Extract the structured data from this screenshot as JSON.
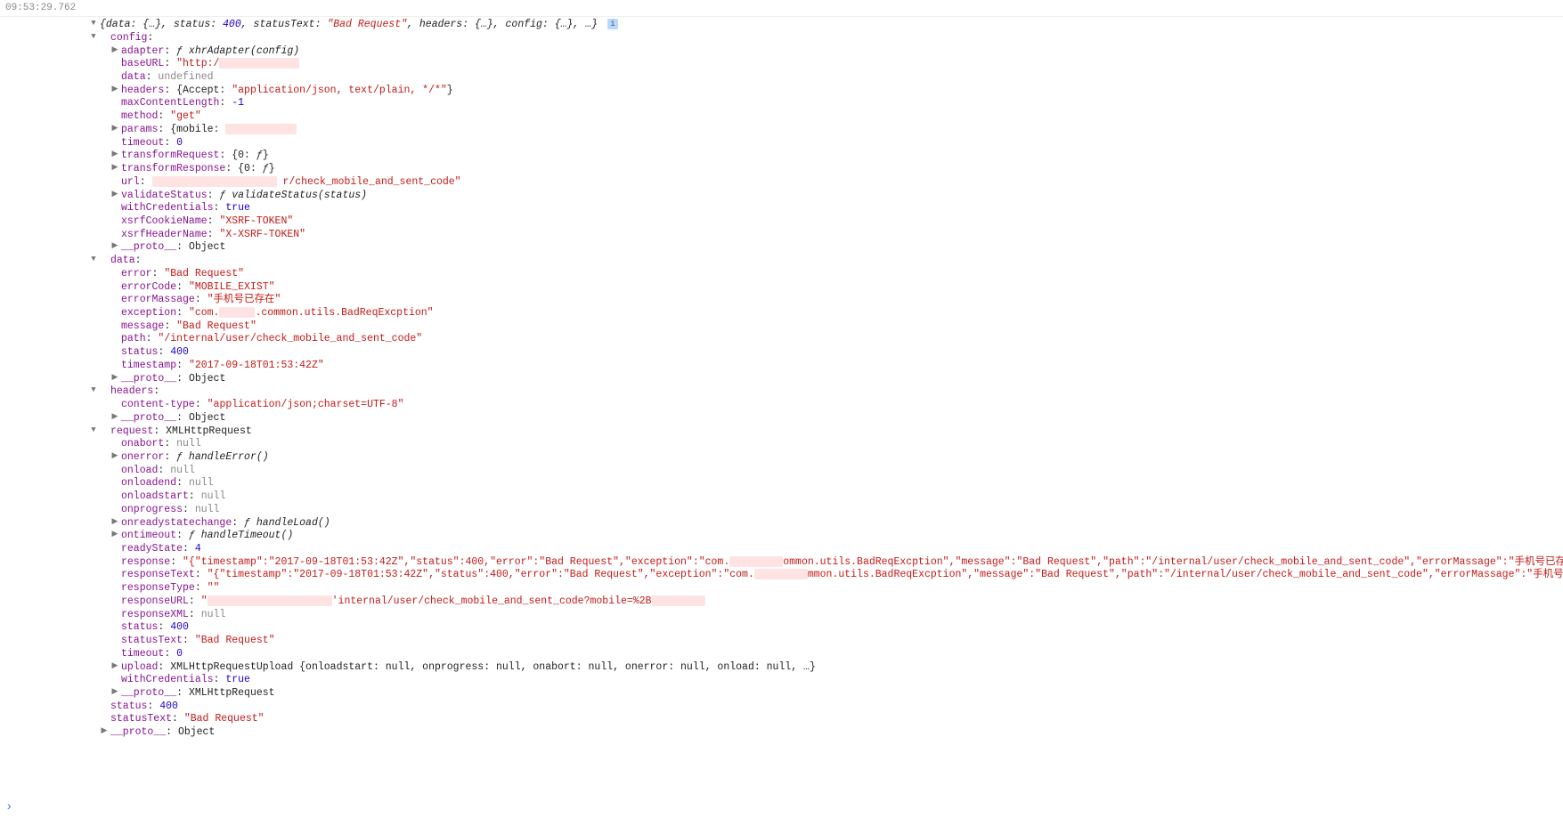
{
  "timestamp": "09:53:29.762",
  "top_summary": "{data: {…}, status: 400, statusText: \"Bad Request\", headers: {…}, config: {…}, …}",
  "status_num": "400",
  "status_text": "\"Bad Request\"",
  "config": {
    "label": "config",
    "adapter_key": "adapter",
    "adapter_val": "ƒ xhrAdapter(config)",
    "baseURL_key": "baseURL",
    "baseURL_val_prefix": "\"http:/",
    "data_key": "data",
    "data_val": "undefined",
    "headers_key": "headers",
    "headers_val": "{Accept: \"application/json, text/plain, */*\"}",
    "headers_accept": "\"application/json, text/plain, */*\"",
    "maxContentLength_key": "maxContentLength",
    "maxContentLength_val": "-1",
    "method_key": "method",
    "method_val": "\"get\"",
    "params_key": "params",
    "params_val_prefix": "{mobile: ",
    "timeout_key": "timeout",
    "timeout_val": "0",
    "transformRequest_key": "transformRequest",
    "transformRequest_val": "{0: ƒ}",
    "transformResponse_key": "transformResponse",
    "transformResponse_val": "{0: ƒ}",
    "url_key": "url",
    "url_suffix": "r/check_mobile_and_sent_code\"",
    "validateStatus_key": "validateStatus",
    "validateStatus_val": "ƒ validateStatus(status)",
    "withCredentials_key": "withCredentials",
    "withCredentials_val": "true",
    "xsrfCookieName_key": "xsrfCookieName",
    "xsrfCookieName_val": "\"XSRF-TOKEN\"",
    "xsrfHeaderName_key": "xsrfHeaderName",
    "xsrfHeaderName_val": "\"X-XSRF-TOKEN\"",
    "proto_key": "__proto__",
    "proto_val": "Object"
  },
  "data": {
    "label": "data",
    "error_key": "error",
    "error_val": "\"Bad Request\"",
    "errorCode_key": "errorCode",
    "errorCode_val": "\"MOBILE_EXIST\"",
    "errorMassage_key": "errorMassage",
    "errorMassage_val": "\"手机号已存在\"",
    "exception_key": "exception",
    "exception_prefix": "\"com.",
    "exception_suffix": ".common.utils.BadReqExcption\"",
    "message_key": "message",
    "message_val": "\"Bad Request\"",
    "path_key": "path",
    "path_val": "\"/internal/user/check_mobile_and_sent_code\"",
    "status_key": "status",
    "status_val": "400",
    "timestamp_key": "timestamp",
    "timestamp_val": "\"2017-09-18T01:53:42Z\"",
    "proto_key": "__proto__",
    "proto_val": "Object"
  },
  "headers": {
    "label": "headers",
    "contentType_key": "content-type",
    "contentType_val": "\"application/json;charset=UTF-8\"",
    "proto_key": "__proto__",
    "proto_val": "Object"
  },
  "request": {
    "label": "request",
    "type": "XMLHttpRequest",
    "onabort_key": "onabort",
    "onabort_val": "null",
    "onerror_key": "onerror",
    "onerror_val": "ƒ handleError()",
    "onload_key": "onload",
    "onload_val": "null",
    "onloadend_key": "onloadend",
    "onloadend_val": "null",
    "onloadstart_key": "onloadstart",
    "onloadstart_val": "null",
    "onprogress_key": "onprogress",
    "onprogress_val": "null",
    "onreadystatechange_key": "onreadystatechange",
    "onreadystatechange_val": "ƒ handleLoad()",
    "ontimeout_key": "ontimeout",
    "ontimeout_val": "ƒ handleTimeout()",
    "readyState_key": "readyState",
    "readyState_val": "4",
    "response_key": "response",
    "response_prefix": "\"{\"timestamp\":\"2017-09-18T01:53:42Z\",\"status\":400,\"error\":\"Bad Request\",\"exception\":\"com.",
    "response_suffix": "ommon.utils.BadReqExcption\",\"message\":\"Bad Request\",\"path\":\"/internal/user/check_mobile_and_sent_code\",\"errorMassage\":\"手机号已存在\",\"err",
    "responseText_key": "responseText",
    "responseText_prefix": "\"{\"timestamp\":\"2017-09-18T01:53:42Z\",\"status\":400,\"error\":\"Bad Request\",\"exception\":\"com.",
    "responseText_suffix": "mmon.utils.BadReqExcption\",\"message\":\"Bad Request\",\"path\":\"/internal/user/check_mobile_and_sent_code\",\"errorMassage\":\"手机号已存在\"",
    "responseType_key": "responseType",
    "responseType_val": "\"\"",
    "responseURL_key": "responseURL",
    "responseURL_mid": "'internal/user/check_mobile_and_sent_code?mobile=%2B",
    "responseXML_key": "responseXML",
    "responseXML_val": "null",
    "status_key": "status",
    "status_val": "400",
    "statusText_key": "statusText",
    "statusText_val": "\"Bad Request\"",
    "timeout_key": "timeout",
    "timeout_val": "0",
    "upload_key": "upload",
    "upload_val": "XMLHttpRequestUpload {onloadstart: null, onprogress: null, onabort: null, onerror: null, onload: null, …}",
    "withCredentials_key": "withCredentials",
    "withCredentials_val": "true",
    "proto_key": "__proto__",
    "proto_val": "XMLHttpRequest"
  },
  "outer": {
    "status_key": "status",
    "status_val": "400",
    "statusText_key": "statusText",
    "statusText_val": "\"Bad Request\"",
    "proto_key": "__proto__",
    "proto_val": "Object"
  },
  "info_glyph": "i",
  "prompt": "›"
}
